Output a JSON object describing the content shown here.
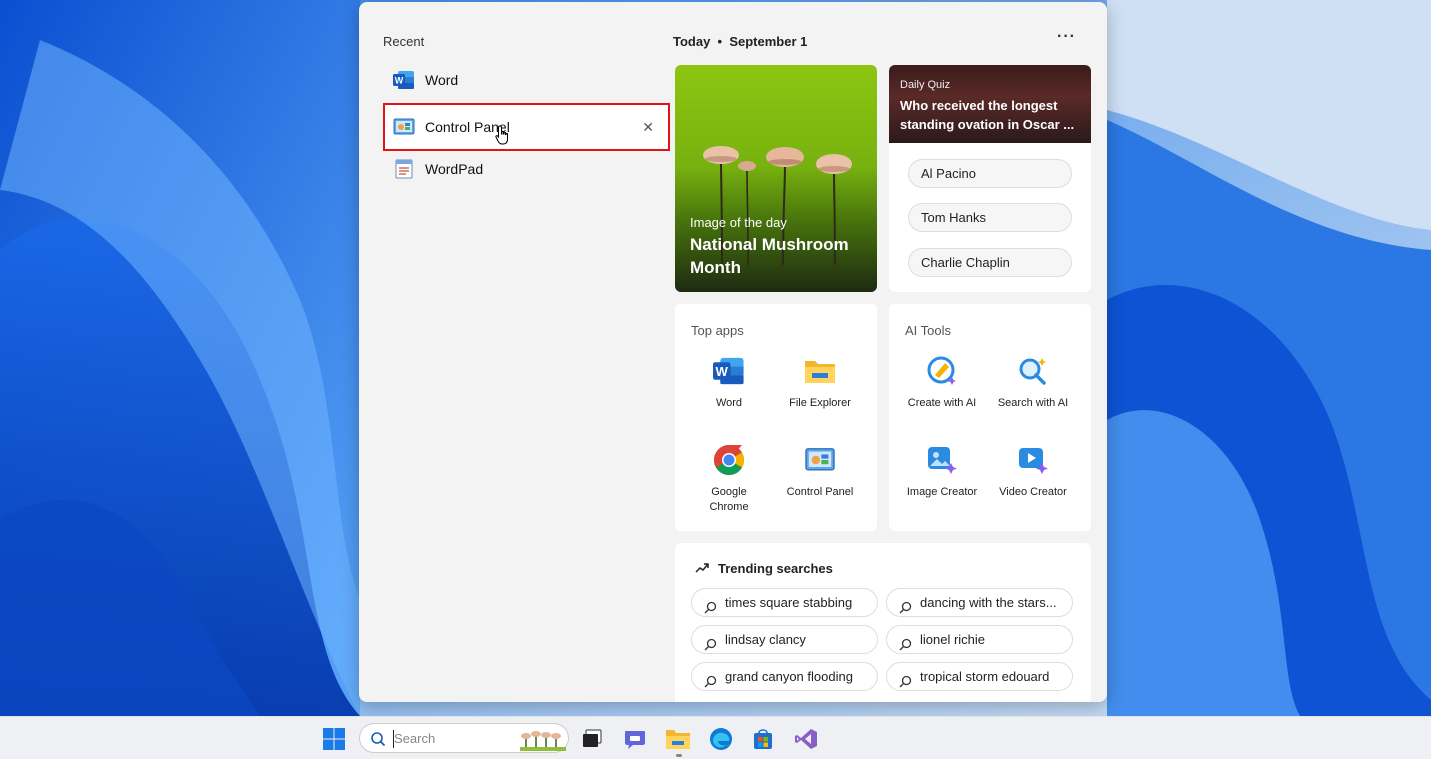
{
  "recent": {
    "title": "Recent",
    "items": [
      {
        "label": "Word",
        "icon": "word-icon"
      },
      {
        "label": "Control Panel",
        "icon": "control-panel-icon",
        "selected": true
      },
      {
        "label": "WordPad",
        "icon": "wordpad-icon"
      }
    ],
    "close_glyph": "✕"
  },
  "today": {
    "title": "Today  •  September 1",
    "more": "···"
  },
  "image_of_day": {
    "small": "Image of the day",
    "title": "National Mushroom Month"
  },
  "quiz": {
    "small": "Daily Quiz",
    "question": "Who received the longest standing ovation in Oscar ...",
    "options": [
      "Al Pacino",
      "Tom Hanks",
      "Charlie Chaplin"
    ]
  },
  "top_apps": {
    "title": "Top apps",
    "apps": [
      {
        "label": "Word",
        "icon": "word-icon"
      },
      {
        "label": "File Explorer",
        "icon": "folder-icon"
      },
      {
        "label": "Google Chrome",
        "icon": "chrome-icon"
      },
      {
        "label": "Control Panel",
        "icon": "control-panel-icon"
      }
    ]
  },
  "ai_tools": {
    "title": "AI Tools",
    "tools": [
      {
        "label": "Create with AI",
        "icon": "create-ai-icon"
      },
      {
        "label": "Search with AI",
        "icon": "search-ai-icon"
      },
      {
        "label": "Image Creator",
        "icon": "image-creator-icon"
      },
      {
        "label": "Video Creator",
        "icon": "video-creator-icon"
      }
    ]
  },
  "trending": {
    "title": "Trending searches",
    "items": [
      "times square stabbing",
      "dancing with the stars...",
      "lindsay clancy",
      "lionel richie",
      "grand canyon flooding",
      "tropical storm edouard"
    ]
  },
  "taskbar": {
    "search_placeholder": "Search",
    "icons": [
      "start-icon",
      "task-view-icon",
      "teams-chat-icon",
      "file-explorer-icon",
      "edge-icon",
      "store-icon",
      "visual-studio-icon"
    ]
  }
}
